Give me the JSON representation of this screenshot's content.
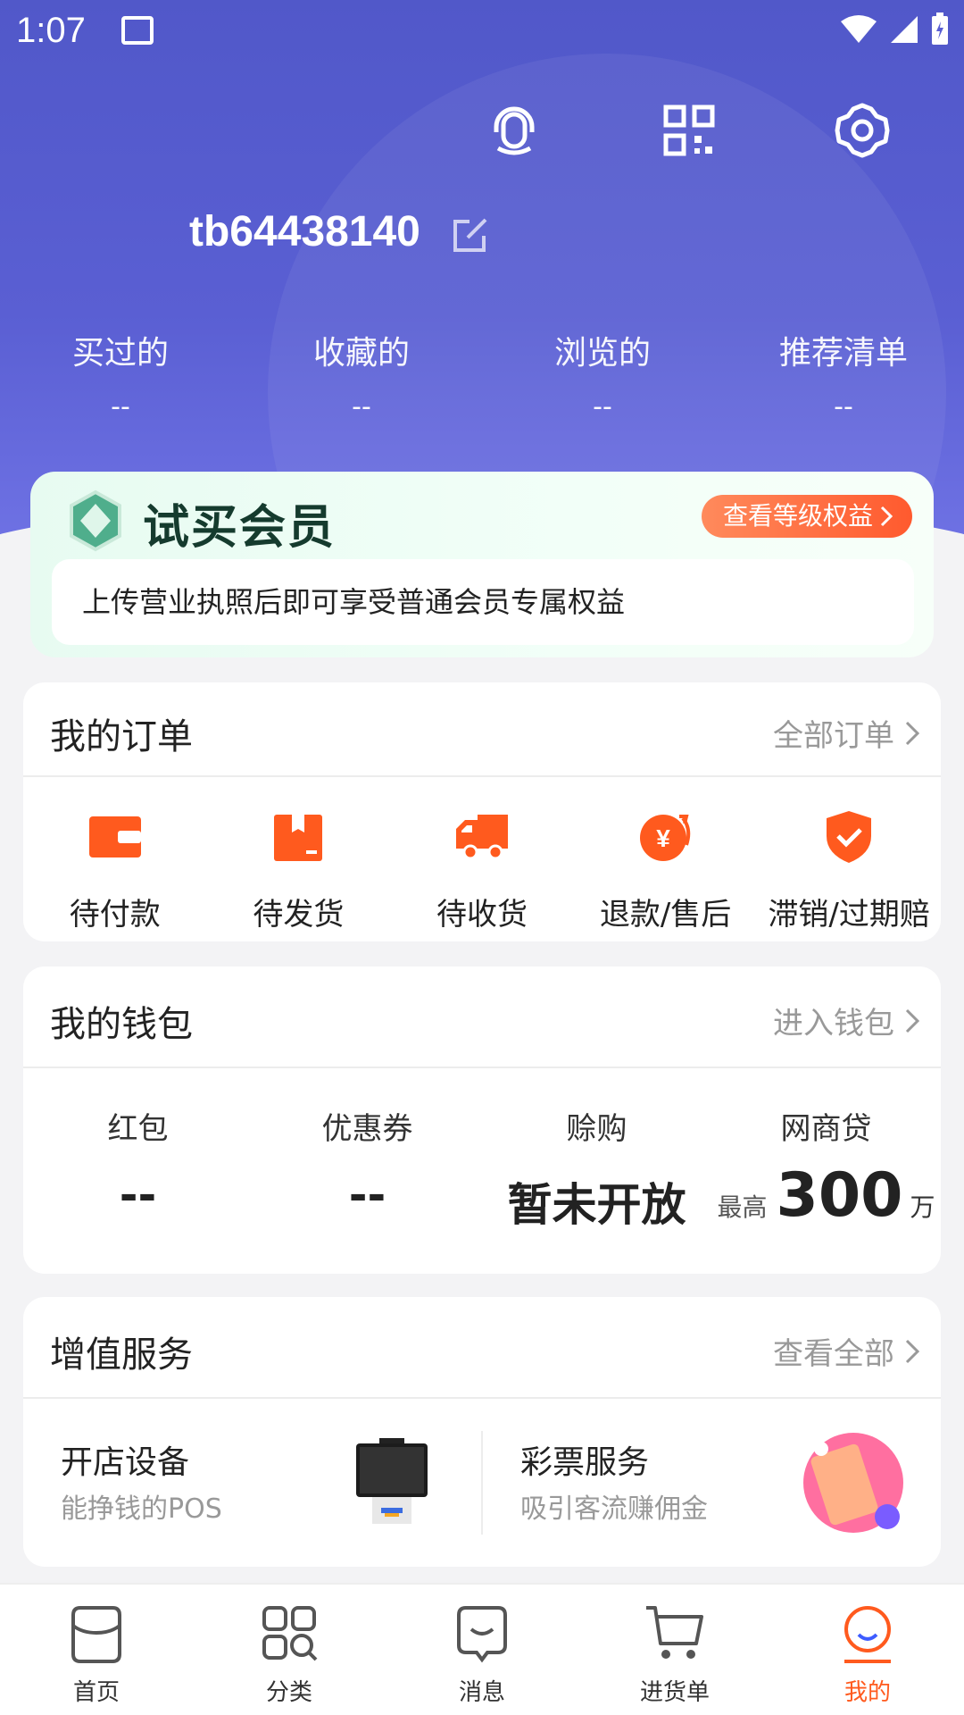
{
  "status_bar": {
    "time": "1:07"
  },
  "header": {
    "username": "tb64438140",
    "icons": [
      "customer-service-icon",
      "qr-code-icon",
      "settings-icon"
    ],
    "stats": [
      {
        "label": "买过的",
        "value": "--"
      },
      {
        "label": "收藏的",
        "value": "--"
      },
      {
        "label": "浏览的",
        "value": "--"
      },
      {
        "label": "推荐清单",
        "value": "--"
      }
    ]
  },
  "member": {
    "title": "试买会员",
    "button": "查看等级权益",
    "subtitle": "上传营业执照后即可享受普通会员专属权益"
  },
  "orders": {
    "title": "我的订单",
    "link": "全部订单",
    "items": [
      {
        "label": "待付款",
        "icon": "wallet-icon"
      },
      {
        "label": "待发货",
        "icon": "package-icon"
      },
      {
        "label": "待收货",
        "icon": "truck-icon"
      },
      {
        "label": "退款/售后",
        "icon": "refund-icon"
      },
      {
        "label": "滞销/过期赔",
        "icon": "shield-check-icon"
      }
    ]
  },
  "wallet": {
    "title": "我的钱包",
    "link": "进入钱包",
    "items": [
      {
        "label": "红包",
        "value": "--"
      },
      {
        "label": "优惠券",
        "value": "--"
      },
      {
        "label": "赊购",
        "value": "暂未开放"
      }
    ],
    "loan": {
      "label": "网商贷",
      "prefix": "最高",
      "amount": "300",
      "unit": "万"
    }
  },
  "services": {
    "title": "增值服务",
    "link": "查看全部",
    "items": [
      {
        "title": "开店设备",
        "subtitle": "能挣钱的POS"
      },
      {
        "title": "彩票服务",
        "subtitle": "吸引客流赚佣金"
      }
    ]
  },
  "tabbar": [
    {
      "label": "首页",
      "icon": "home-icon"
    },
    {
      "label": "分类",
      "icon": "category-icon"
    },
    {
      "label": "消息",
      "icon": "message-icon"
    },
    {
      "label": "进货单",
      "icon": "cart-icon"
    },
    {
      "label": "我的",
      "icon": "profile-icon",
      "active": true
    }
  ],
  "colors": {
    "header": "#5a5fd3",
    "accent": "#ff5a1e",
    "member_bg": "#e7fbf1"
  }
}
